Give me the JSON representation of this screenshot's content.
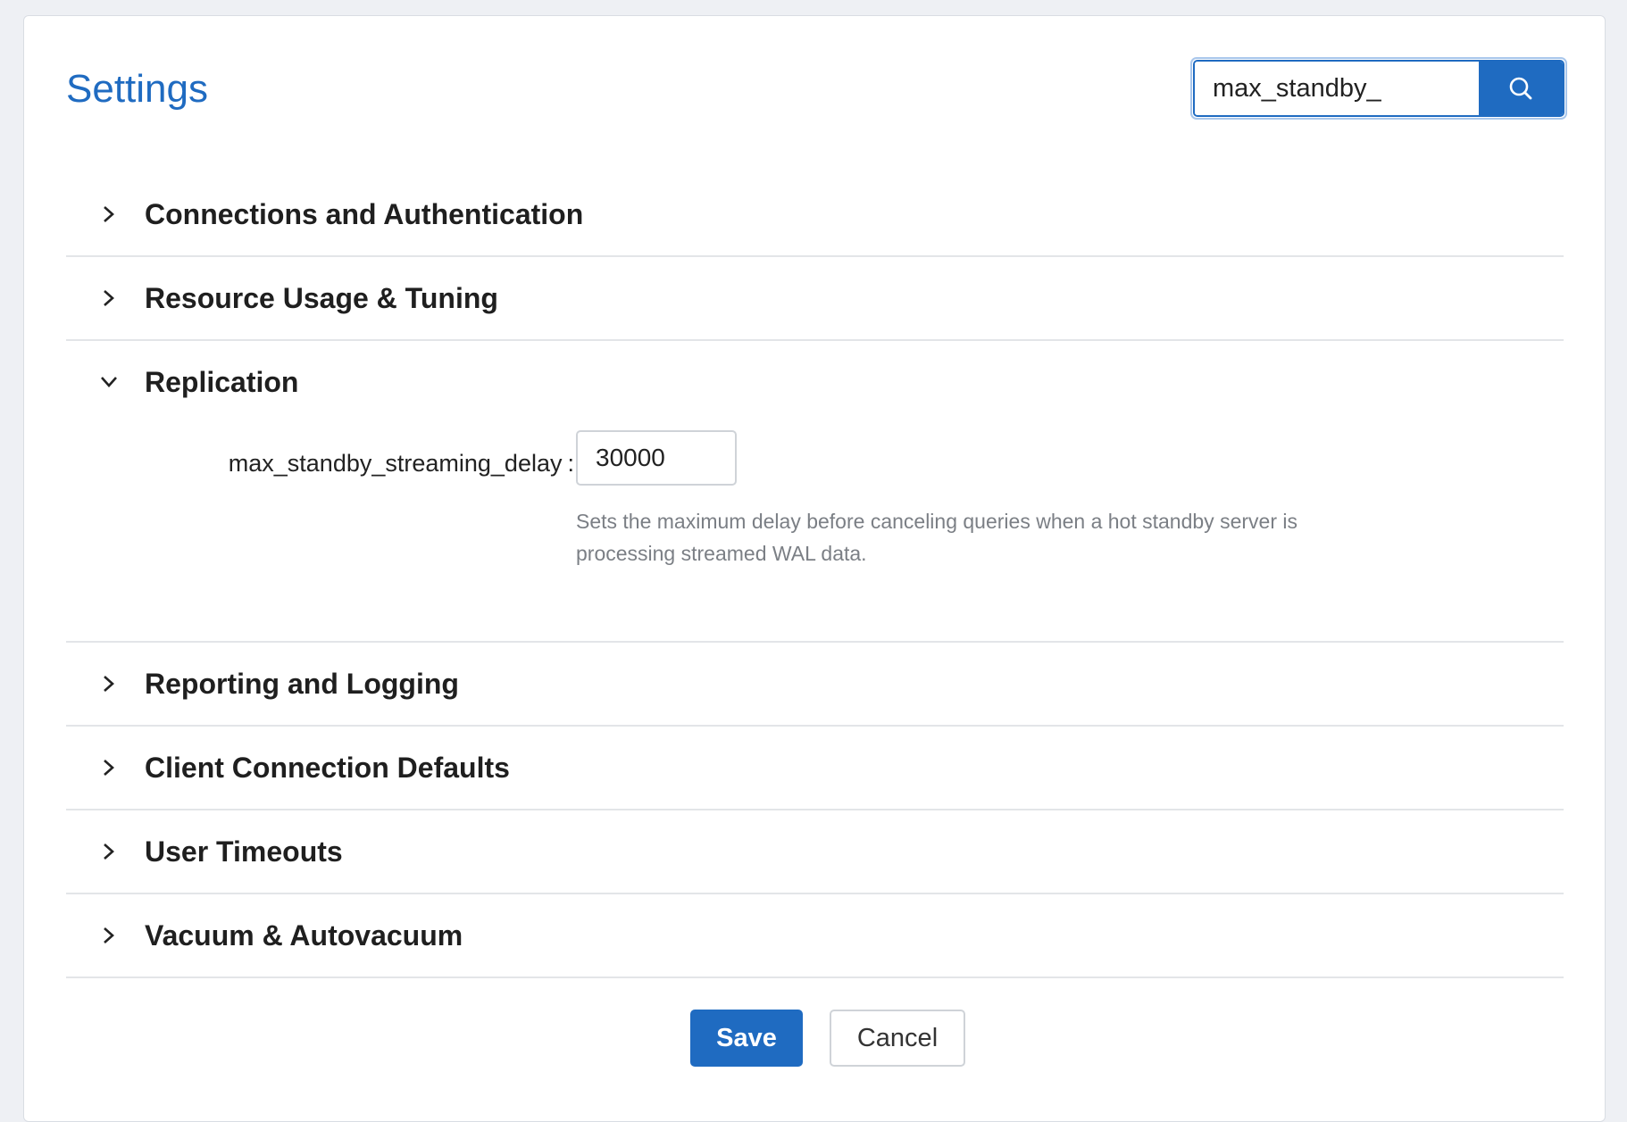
{
  "page": {
    "title": "Settings"
  },
  "search": {
    "value": "max_standby_",
    "button_icon": "search-icon"
  },
  "sections": [
    {
      "label": "Connections and Authentication",
      "expanded": false
    },
    {
      "label": "Resource Usage & Tuning",
      "expanded": false
    },
    {
      "label": "Replication",
      "expanded": true,
      "field": {
        "label": "max_standby_streaming_delay",
        "separator": ":",
        "value": "30000",
        "help": "Sets the maximum delay before canceling queries when a hot standby server is processing streamed WAL data."
      }
    },
    {
      "label": "Reporting and Logging",
      "expanded": false
    },
    {
      "label": "Client Connection Defaults",
      "expanded": false
    },
    {
      "label": "User Timeouts",
      "expanded": false
    },
    {
      "label": "Vacuum & Autovacuum",
      "expanded": false
    }
  ],
  "actions": {
    "save_label": "Save",
    "cancel_label": "Cancel"
  },
  "colors": {
    "accent": "#1f6bc1",
    "divider": "#e3e5e8",
    "help_text": "#7b7f85"
  }
}
